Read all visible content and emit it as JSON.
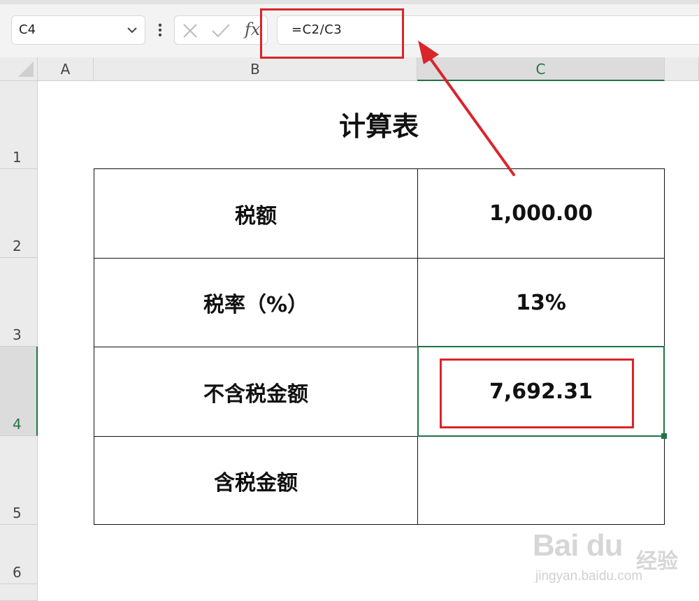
{
  "formula_bar": {
    "name_box": "C4",
    "fx_label": "fx",
    "formula": "=C2/C3"
  },
  "columns": [
    "A",
    "B",
    "C"
  ],
  "rows": [
    "1",
    "2",
    "3",
    "4",
    "5",
    "6"
  ],
  "sheet": {
    "title": "计算表",
    "table": [
      {
        "label": "税额",
        "value": "1,000.00"
      },
      {
        "label": "税率（%）",
        "value": "13%"
      },
      {
        "label": "不含税金额",
        "value": "7,692.31"
      },
      {
        "label": "含税金额",
        "value": ""
      }
    ]
  },
  "selected_cell": "C4",
  "watermark": {
    "logo": "Bai du",
    "text": "经验",
    "url": "jingyan.baidu.com"
  },
  "colors": {
    "annotation_red": "#d9252a",
    "selection_green": "#217346"
  }
}
